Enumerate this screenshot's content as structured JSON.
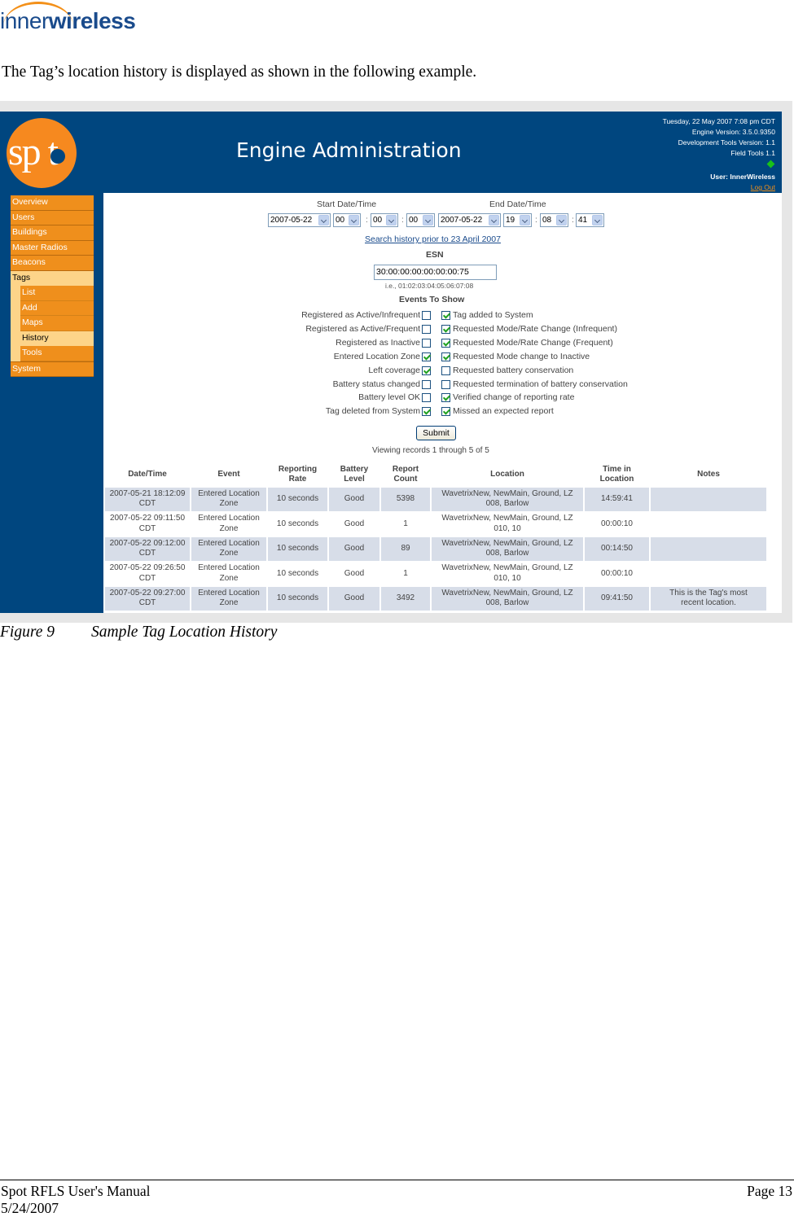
{
  "document": {
    "brand_light": "inner",
    "brand_bold": "wireless",
    "intro": "The Tag’s location history is displayed as shown in the following example.",
    "figure_number": "Figure 9",
    "figure_caption": "Sample Tag Location History",
    "footer_title": "Spot RFLS User's Manual",
    "footer_date": "5/24/2007",
    "footer_page": "Page 13"
  },
  "app": {
    "logo_text": "sp t",
    "title": "Engine Administration",
    "header_info": {
      "datetime": "Tuesday, 22 May 2007 7:08 pm CDT",
      "engine_version": "Engine Version: 3.5.0.9350",
      "dev_tools_version": "Development Tools Version: 1.1",
      "field_tools": "Field Tools 1.1",
      "user": "User: InnerWireless",
      "logout": "Log Out"
    },
    "colors": {
      "header_bg": "#00467f",
      "nav_orange": "#ef8f1c",
      "nav_active": "#fdd489",
      "row_alt": "#d7dde8"
    },
    "nav": {
      "items": [
        "Overview",
        "Users",
        "Buildings",
        "Master Radios",
        "Beacons"
      ],
      "tags": "Tags",
      "tags_sub": [
        "List",
        "Add",
        "Maps",
        "History",
        "Tools"
      ],
      "system": "System"
    },
    "form": {
      "start_label": "Start Date/Time",
      "end_label": "End Date/Time",
      "start": {
        "date": "2007-05-22",
        "hour": "00",
        "minute": "00",
        "second": "00"
      },
      "end": {
        "date": "2007-05-22",
        "hour": "19",
        "minute": "08",
        "second": "41"
      },
      "colon": ":",
      "search_prior_link": "Search history prior to 23 April 2007",
      "esn_label": "ESN",
      "esn_value": "30:00:00:00:00:00:00:75",
      "esn_hint": "i.e., 01:02:03:04:05:06:07:08",
      "events_label": "Events To Show",
      "events_left": [
        {
          "label": "Registered as Active/Infrequent",
          "checked": false
        },
        {
          "label": "Registered as Active/Frequent",
          "checked": false
        },
        {
          "label": "Registered as Inactive",
          "checked": false
        },
        {
          "label": "Entered Location Zone",
          "checked": true
        },
        {
          "label": "Left coverage",
          "checked": true
        },
        {
          "label": "Battery status changed",
          "checked": false
        },
        {
          "label": "Battery level OK",
          "checked": false
        },
        {
          "label": "Tag deleted from System",
          "checked": true
        }
      ],
      "events_right": [
        {
          "label": "Tag added to System",
          "checked": true
        },
        {
          "label": "Requested Mode/Rate Change (Infrequent)",
          "checked": true
        },
        {
          "label": "Requested Mode/Rate Change (Frequent)",
          "checked": true
        },
        {
          "label": "Requested Mode change to Inactive",
          "checked": true
        },
        {
          "label": "Requested battery conservation",
          "checked": false
        },
        {
          "label": "Requested termination of battery conservation",
          "checked": false
        },
        {
          "label": "Verified change of reporting rate",
          "checked": true
        },
        {
          "label": "Missed an expected report",
          "checked": true
        }
      ],
      "submit": "Submit",
      "records_text": "Viewing records 1 through 5 of 5"
    },
    "table": {
      "headers": [
        [
          "Date/Time",
          ""
        ],
        [
          "Event",
          ""
        ],
        [
          "Reporting",
          "Rate"
        ],
        [
          "Battery",
          "Level"
        ],
        [
          "Report",
          "Count"
        ],
        [
          "Location",
          ""
        ],
        [
          "Time in",
          "Location"
        ],
        [
          "Notes",
          ""
        ]
      ],
      "rows": [
        {
          "date": "2007-05-21 18:12:09",
          "tz": "CDT",
          "event1": "Entered Location",
          "event2": "Zone",
          "rate": "10 seconds",
          "battery": "Good",
          "count": "5398",
          "loc1": "WavetrixNew, NewMain, Ground, LZ",
          "loc2": "008, Barlow",
          "time": "14:59:41",
          "note1": "",
          "note2": ""
        },
        {
          "date": "2007-05-22 09:11:50",
          "tz": "CDT",
          "event1": "Entered Location",
          "event2": "Zone",
          "rate": "10 seconds",
          "battery": "Good",
          "count": "1",
          "loc1": "WavetrixNew, NewMain, Ground, LZ",
          "loc2": "010, 10",
          "time": "00:00:10",
          "note1": "",
          "note2": ""
        },
        {
          "date": "2007-05-22 09:12:00",
          "tz": "CDT",
          "event1": "Entered Location",
          "event2": "Zone",
          "rate": "10 seconds",
          "battery": "Good",
          "count": "89",
          "loc1": "WavetrixNew, NewMain, Ground, LZ",
          "loc2": "008, Barlow",
          "time": "00:14:50",
          "note1": "",
          "note2": ""
        },
        {
          "date": "2007-05-22 09:26:50",
          "tz": "CDT",
          "event1": "Entered Location",
          "event2": "Zone",
          "rate": "10 seconds",
          "battery": "Good",
          "count": "1",
          "loc1": "WavetrixNew, NewMain, Ground, LZ",
          "loc2": "010, 10",
          "time": "00:00:10",
          "note1": "",
          "note2": ""
        },
        {
          "date": "2007-05-22 09:27:00",
          "tz": "CDT",
          "event1": "Entered Location",
          "event2": "Zone",
          "rate": "10 seconds",
          "battery": "Good",
          "count": "3492",
          "loc1": "WavetrixNew, NewMain, Ground, LZ",
          "loc2": "008, Barlow",
          "time": "09:41:50",
          "note1": "This is the Tag's most",
          "note2": "recent location."
        }
      ]
    }
  }
}
